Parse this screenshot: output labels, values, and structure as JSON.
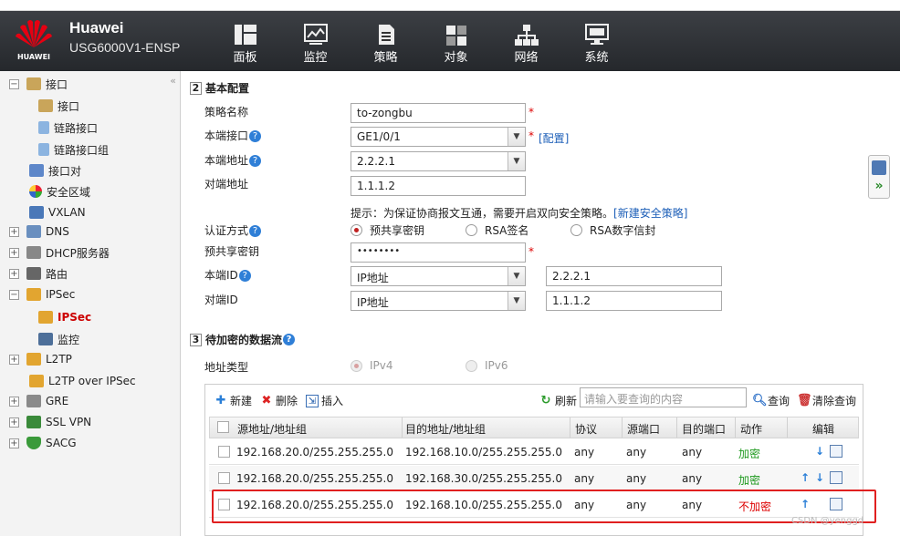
{
  "header": {
    "brand": "Huawei",
    "model": "USG6000V1-ENSP",
    "logo_text": "HUAWEI",
    "nav": [
      {
        "label": "面板",
        "icon": "dashboard-icon"
      },
      {
        "label": "监控",
        "icon": "monitor-chart-icon"
      },
      {
        "label": "策略",
        "icon": "policy-document-icon"
      },
      {
        "label": "对象",
        "icon": "objects-icon"
      },
      {
        "label": "网络",
        "icon": "network-topology-icon"
      },
      {
        "label": "系统",
        "icon": "system-computer-icon"
      }
    ]
  },
  "sidebar": {
    "collapse": "«",
    "items": [
      {
        "label": "接口",
        "pm": "−"
      },
      {
        "label": "接口"
      },
      {
        "label": "链路接口"
      },
      {
        "label": "链路接口组"
      },
      {
        "label": "接口对"
      },
      {
        "label": "安全区域"
      },
      {
        "label": "VXLAN"
      },
      {
        "label": "DNS",
        "pm": "+"
      },
      {
        "label": "DHCP服务器",
        "pm": "+"
      },
      {
        "label": "路由",
        "pm": "+"
      },
      {
        "label": "IPSec",
        "pm": "−"
      },
      {
        "label": "IPSec"
      },
      {
        "label": "监控"
      },
      {
        "label": "L2TP",
        "pm": "+"
      },
      {
        "label": "L2TP over IPSec"
      },
      {
        "label": "GRE",
        "pm": "+"
      },
      {
        "label": "SSL VPN",
        "pm": "+"
      },
      {
        "label": "SACG",
        "pm": "+"
      }
    ]
  },
  "basic": {
    "num": "2",
    "title": "基本配置",
    "policy_name_label": "策略名称",
    "policy_name": "to-zongbu",
    "local_if_label": "本端接口",
    "local_if": "GE1/0/1",
    "config_link": "[配置]",
    "local_addr_label": "本端地址",
    "local_addr": "2.2.2.1",
    "peer_addr_label": "对端地址",
    "peer_addr": "1.1.1.2",
    "hint": "提示：为保证协商报文互通，需要开启双向安全策略。",
    "new_policy_link": "[新建安全策略]",
    "auth_label": "认证方式",
    "auth_options": [
      "预共享密钥",
      "RSA签名",
      "RSA数字信封"
    ],
    "psk_label": "预共享密钥",
    "psk": "••••••••",
    "local_id_label": "本端ID",
    "local_id_type": "IP地址",
    "local_id": "2.2.2.1",
    "peer_id_label": "对端ID",
    "peer_id_type": "IP地址",
    "peer_id": "1.1.1.2",
    "required": "*"
  },
  "flow": {
    "num": "3",
    "title": "待加密的数据流",
    "addr_type_label": "地址类型",
    "addr_types": [
      "IPv4",
      "IPv6"
    ],
    "toolbar": {
      "new": "新建",
      "delete": "删除",
      "insert": "插入",
      "refresh": "刷新",
      "search_placeholder": "请输入要查询的内容",
      "query": "查询",
      "clear": "清除查询"
    },
    "columns": [
      "源地址/地址组",
      "目的地址/地址组",
      "协议",
      "源端口",
      "目的端口",
      "动作",
      "编辑"
    ],
    "rows": [
      {
        "src": "192.168.20.0/255.255.255.0",
        "dst": "192.168.10.0/255.255.255.0",
        "proto": "any",
        "sport": "any",
        "dport": "any",
        "action": "加密"
      },
      {
        "src": "192.168.20.0/255.255.255.0",
        "dst": "192.168.30.0/255.255.255.0",
        "proto": "any",
        "sport": "any",
        "dport": "any",
        "action": "加密"
      },
      {
        "src": "192.168.20.0/255.255.255.0",
        "dst": "192.168.10.0/255.255.255.0",
        "proto": "any",
        "sport": "any",
        "dport": "any",
        "action": "不加密"
      }
    ]
  },
  "watermark": "CSDN @yenggd"
}
